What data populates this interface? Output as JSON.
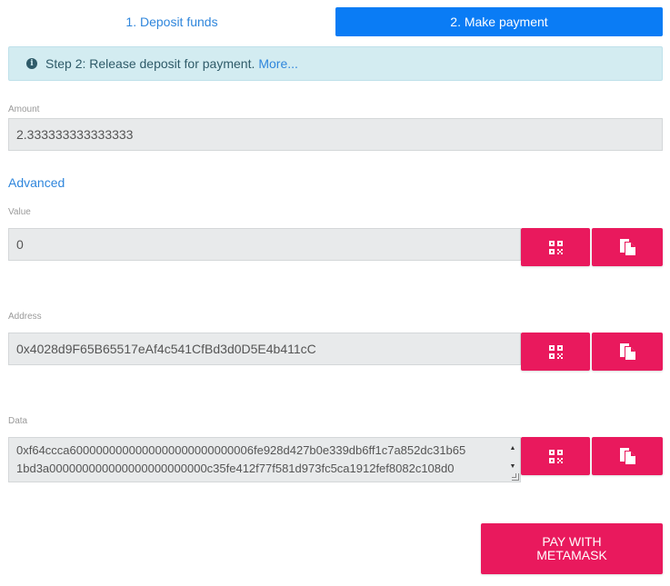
{
  "tabs": [
    {
      "label": "1. Deposit funds",
      "active": false
    },
    {
      "label": "2. Make payment",
      "active": true
    }
  ],
  "info": {
    "text": "Step 2: Release deposit for payment.",
    "more": "More..."
  },
  "amount": {
    "label": "Amount",
    "value": "2.333333333333333"
  },
  "advanced_link": "Advanced",
  "value_field": {
    "label": "Value",
    "value": "0"
  },
  "address_field": {
    "label": "Address",
    "value": "0x4028d9F65B65517eAf4c541CfBd3d0D5E4b411cC"
  },
  "data_field": {
    "label": "Data",
    "line1": "0xf64ccca6000000000000000000000000006fe928d427b0e339db6ff1c7a852dc31b65",
    "line2": "1bd3a000000000000000000000000c35fe412f77f581d973fc5ca1912fef8082c108d0"
  },
  "pay_button": "PAY WITH METAMASK",
  "icons": {
    "qr": "qr-code-icon",
    "copy": "copy-icon",
    "info": "info-circle-icon"
  },
  "colors": {
    "accent": "#e9195d",
    "tab_active": "#0a7cf5",
    "link": "#2f86dc",
    "info_bg": "#d3ecf1"
  }
}
